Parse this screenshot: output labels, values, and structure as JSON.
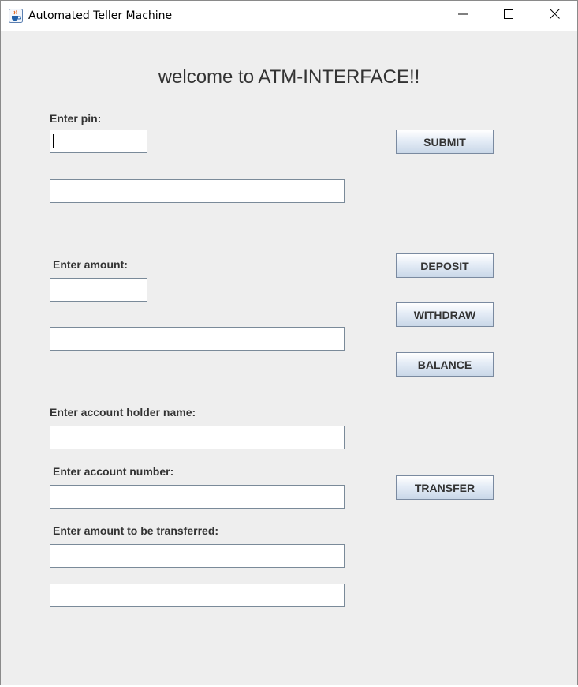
{
  "window": {
    "title": "Automated Teller Machine",
    "minimize": "minimize",
    "maximize": "maximize",
    "close": "close"
  },
  "heading": "welcome to ATM-INTERFACE!!",
  "labels": {
    "pin": "Enter pin:",
    "amount": "Enter amount:",
    "holder_name": "Enter account holder name:",
    "account_number": "Enter account number:",
    "transfer_amount": "Enter amount to be transferred:"
  },
  "fields": {
    "pin": "",
    "pin_output": "",
    "amount": "",
    "amount_output": "",
    "holder_name": "",
    "account_number": "",
    "transfer_amount": "",
    "transfer_output": ""
  },
  "buttons": {
    "submit": "SUBMIT",
    "deposit": "DEPOSIT",
    "withdraw": "WITHDRAW",
    "balance": "BALANCE",
    "transfer": "TRANSFER"
  },
  "colors": {
    "window_bg": "#eeeeee",
    "text": "#333333",
    "button_border": "#7a8aa0"
  },
  "icons": {
    "app": "java-coffee-cup-icon",
    "minimize": "minimize-icon",
    "maximize": "maximize-icon",
    "close": "close-icon"
  }
}
